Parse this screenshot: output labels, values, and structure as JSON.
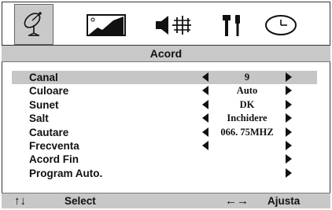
{
  "tabs": [
    {
      "name": "satellite-dish-icon",
      "active": true
    },
    {
      "name": "picture-icon",
      "active": false
    },
    {
      "name": "speaker-icon",
      "active": false
    },
    {
      "name": "tools-icon",
      "active": false
    },
    {
      "name": "clock-icon",
      "active": false
    }
  ],
  "title": "Acord",
  "rows": [
    {
      "label": "Canal",
      "value": "9",
      "left_arrow": true,
      "right_arrow": true,
      "selected": true
    },
    {
      "label": "Culoare",
      "value": "Auto",
      "left_arrow": true,
      "right_arrow": true
    },
    {
      "label": "Sunet",
      "value": "DK",
      "left_arrow": true,
      "right_arrow": true
    },
    {
      "label": "Salt",
      "value": "Inchidere",
      "left_arrow": true,
      "right_arrow": true
    },
    {
      "label": "Cautare",
      "value": "066. 75MHZ",
      "left_arrow": true,
      "right_arrow": true
    },
    {
      "label": "Frecventa",
      "value": "",
      "left_arrow": true,
      "right_arrow": true
    },
    {
      "label": "Acord Fin",
      "value": "",
      "left_arrow": false,
      "right_arrow": true
    },
    {
      "label": "Program Auto.",
      "value": "",
      "left_arrow": false,
      "right_arrow": true
    }
  ],
  "footer": {
    "updown_glyph": "↑↓",
    "select_label": "Select",
    "leftright_glyph": "←→",
    "adjust_label": "Ajusta"
  },
  "colors": {
    "highlight": "#c6c6c6",
    "bar": "#c8c8c8",
    "text": "#111111"
  }
}
